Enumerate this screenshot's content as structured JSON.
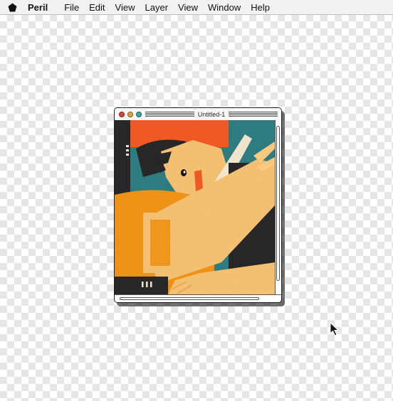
{
  "menubar": {
    "logo_icon": "pentagon-logo-icon",
    "app_name": "Peril",
    "items": [
      "File",
      "Edit",
      "View",
      "Layer",
      "View",
      "Window",
      "Help"
    ]
  },
  "window": {
    "title": "Untitled-1",
    "buttons": {
      "close_color": "#e0443e",
      "minimize_color": "#e9a23b",
      "zoom_color": "#3aa7a3"
    }
  },
  "artwork": {
    "description_icon": "illustration-image",
    "palette": {
      "orange": "#f7941d",
      "red_orange": "#ef5a24",
      "teal": "#2e7c80",
      "dark": "#272727",
      "skin": "#fcc97e",
      "cream": "#f1e4cd"
    }
  }
}
